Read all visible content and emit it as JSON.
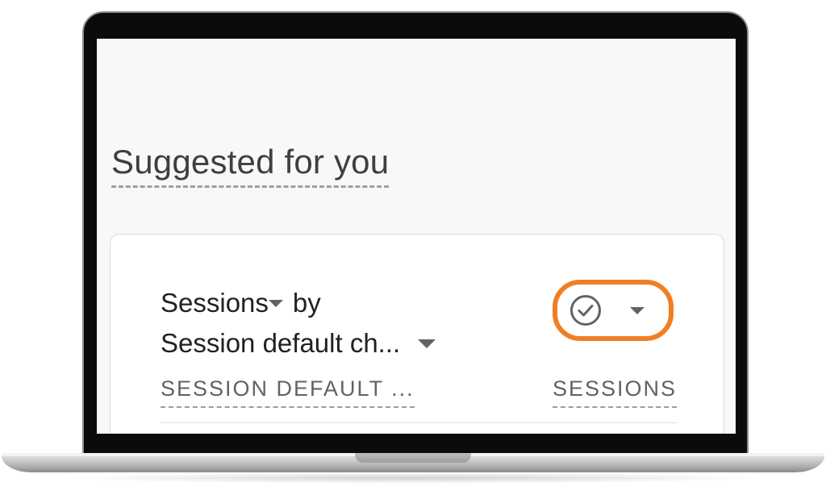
{
  "section": {
    "title": "Suggested for you"
  },
  "card": {
    "metric_label": "Sessions",
    "by_word": "by",
    "dimension_label": "Session default ch...",
    "status_icon": "check-circle-icon",
    "columns": {
      "dimension": "SESSION DEFAULT ...",
      "metric": "SESSIONS"
    }
  },
  "colors": {
    "highlight": "#f07f24",
    "text_primary": "#202124",
    "text_secondary": "#5f6368",
    "screen_bg": "#f8f8f8"
  }
}
